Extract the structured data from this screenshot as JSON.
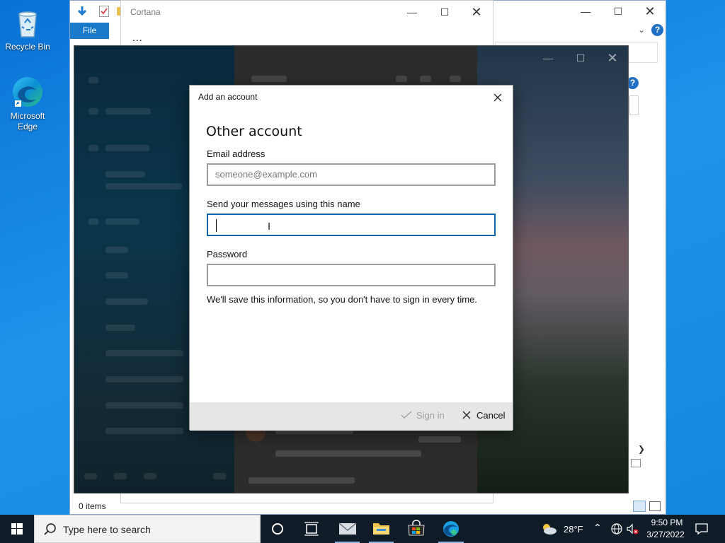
{
  "desktop": {
    "icons": [
      {
        "label": "Recycle Bin"
      },
      {
        "label": "Microsoft Edge"
      }
    ]
  },
  "explorer": {
    "file_tab": "File",
    "status_items": "0 items"
  },
  "cortana": {
    "title": "Cortana",
    "more": "..."
  },
  "dialog": {
    "title": "Add an account",
    "heading": "Other account",
    "email": {
      "label": "Email address",
      "placeholder": "someone@example.com",
      "value": ""
    },
    "name": {
      "label": "Send your messages using this name",
      "value": ""
    },
    "password": {
      "label": "Password",
      "value": ""
    },
    "note": "We'll save this information, so you don't have to sign in every time.",
    "sign_in": "Sign in",
    "cancel": "Cancel"
  },
  "taskbar": {
    "search_placeholder": "Type here to search",
    "weather": "28°F",
    "time": "9:50 PM",
    "date": "3/27/2022"
  },
  "colors": {
    "desktop": "#1587dd",
    "accent": "#0f63a8",
    "taskbar": "#101820"
  }
}
